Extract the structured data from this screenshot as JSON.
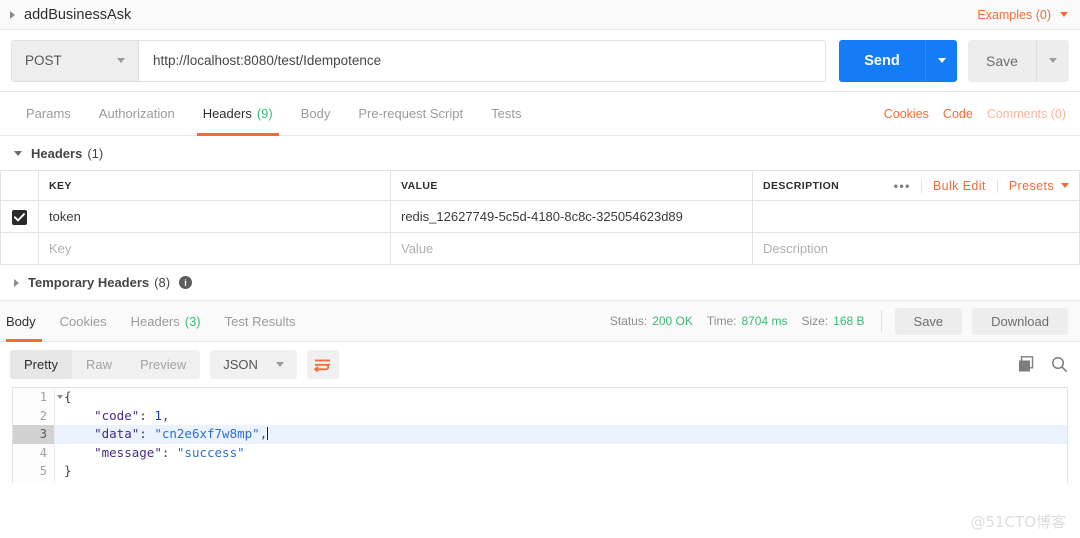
{
  "request": {
    "name": "addBusinessAsk",
    "expander_icon": "triangle-right-icon",
    "examples_label": "Examples (0)",
    "method": "POST",
    "url": "http://localhost:8080/test/Idempotence",
    "send_label": "Send",
    "save_label": "Save",
    "tabs": [
      {
        "label": "Params",
        "count": "",
        "active": false
      },
      {
        "label": "Authorization",
        "count": "",
        "active": false
      },
      {
        "label": "Headers",
        "count": "(9)",
        "active": true
      },
      {
        "label": "Body",
        "count": "",
        "active": false
      },
      {
        "label": "Pre-request Script",
        "count": "",
        "active": false
      },
      {
        "label": "Tests",
        "count": "",
        "active": false
      }
    ],
    "links": {
      "cookies": "Cookies",
      "code": "Code",
      "comments": "Comments (0)"
    }
  },
  "headers_section": {
    "title": "Headers",
    "count": "(1)",
    "columns": {
      "key": "KEY",
      "value": "VALUE",
      "description": "DESCRIPTION"
    },
    "actions": {
      "dots": "•••",
      "bulk_edit": "Bulk Edit",
      "presets": "Presets"
    },
    "rows": [
      {
        "checked": true,
        "key": "token",
        "value": "redis_12627749-5c5d-4180-8c8c-325054623d89",
        "description": ""
      }
    ],
    "placeholders": {
      "key": "Key",
      "value": "Value",
      "description": "Description"
    }
  },
  "temporary_headers": {
    "title": "Temporary Headers",
    "count": "(8)",
    "info_icon": "info-icon"
  },
  "response": {
    "tabs": [
      {
        "label": "Body",
        "count": "",
        "active": true
      },
      {
        "label": "Cookies",
        "count": "",
        "active": false
      },
      {
        "label": "Headers",
        "count": "(3)",
        "active": false
      },
      {
        "label": "Test Results",
        "count": "",
        "active": false
      }
    ],
    "meta": {
      "status_label": "Status:",
      "status_value": "200 OK",
      "time_label": "Time:",
      "time_value": "8704 ms",
      "size_label": "Size:",
      "size_value": "168 B"
    },
    "save_label": "Save",
    "download_label": "Download",
    "format_tabs": [
      {
        "label": "Pretty",
        "active": true
      },
      {
        "label": "Raw",
        "active": false
      },
      {
        "label": "Preview",
        "active": false
      }
    ],
    "language": "JSON",
    "wrap_icon": "word-wrap-icon",
    "copy_icon": "copy-icon",
    "search_icon": "search-icon",
    "body_lines": [
      {
        "num": "1",
        "foldable": true,
        "current": false,
        "tokens": [
          {
            "t": "p",
            "v": "{"
          }
        ]
      },
      {
        "num": "2",
        "foldable": false,
        "current": false,
        "tokens": [
          {
            "t": "p",
            "v": "    "
          },
          {
            "t": "k",
            "v": "\"code\""
          },
          {
            "t": "p",
            "v": ": "
          },
          {
            "t": "n",
            "v": "1"
          },
          {
            "t": "p",
            "v": ","
          }
        ]
      },
      {
        "num": "3",
        "foldable": false,
        "current": true,
        "tokens": [
          {
            "t": "p",
            "v": "    "
          },
          {
            "t": "k",
            "v": "\"data\""
          },
          {
            "t": "p",
            "v": ": "
          },
          {
            "t": "s",
            "v": "\"cn2e6xf7w8mp\""
          },
          {
            "t": "p",
            "v": ","
          }
        ]
      },
      {
        "num": "4",
        "foldable": false,
        "current": false,
        "tokens": [
          {
            "t": "p",
            "v": "    "
          },
          {
            "t": "k",
            "v": "\"message\""
          },
          {
            "t": "p",
            "v": ": "
          },
          {
            "t": "s",
            "v": "\"success\""
          }
        ]
      },
      {
        "num": "5",
        "foldable": false,
        "current": false,
        "tokens": [
          {
            "t": "p",
            "v": "}"
          }
        ]
      }
    ]
  },
  "watermark": "@51CTO博客",
  "colors": {
    "accent_orange": "#f26b3a",
    "send_blue": "#157cf7",
    "status_green": "#3db87a"
  }
}
